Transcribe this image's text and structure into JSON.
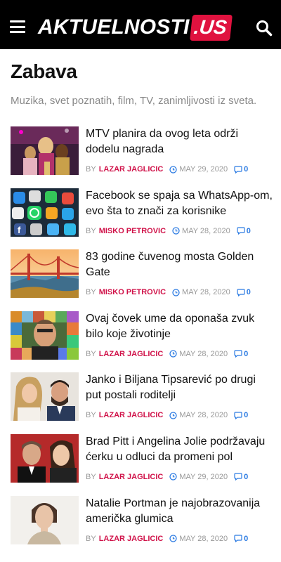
{
  "header": {
    "logo_main": "AKTUELNOSTI",
    "logo_badge": ".US",
    "menu_icon": "hamburger-menu-icon",
    "search_icon": "search-icon",
    "background": "#000000",
    "brand_color": "#e0123f"
  },
  "category": {
    "title": "Zabava",
    "description": "Muzika, svet poznatih, film, TV, zanimljivosti iz sveta."
  },
  "meta_labels": {
    "by": "BY"
  },
  "articles": [
    {
      "title": "MTV planira da ovog leta održi dodelu nagrada",
      "author": "LAZAR JAGLICIC",
      "date": "MAY 29, 2020",
      "comments": "0"
    },
    {
      "title": "Facebook se spaja sa WhatsApp-om, evo šta to znači za korisnike",
      "author": "MISKO PETROVIC",
      "date": "MAY 28, 2020",
      "comments": "0"
    },
    {
      "title": "83 godine čuvenog mosta Golden Gate",
      "author": "MISKO PETROVIC",
      "date": "MAY 28, 2020",
      "comments": "0"
    },
    {
      "title": "Ovaj čovek ume da oponaša zvuk bilo koje životinje",
      "author": "LAZAR JAGLICIC",
      "date": "MAY 28, 2020",
      "comments": "0"
    },
    {
      "title": "Janko i Biljana Tipsarević po drugi put postali roditelji",
      "author": "LAZAR JAGLICIC",
      "date": "MAY 28, 2020",
      "comments": "0"
    },
    {
      "title": "Brad Pitt i Angelina Jolie podržavaju ćerku u odluci da promeni pol",
      "author": "LAZAR JAGLICIC",
      "date": "MAY 29, 2020",
      "comments": "0"
    },
    {
      "title": "Natalie Portman je najobrazovanija američka glumica",
      "author": "LAZAR JAGLICIC",
      "date": "MAY 28, 2020",
      "comments": "0"
    }
  ],
  "colors": {
    "author": "#d01249",
    "comments": "#2a7ae2",
    "meta": "#999999",
    "description": "#888888"
  }
}
